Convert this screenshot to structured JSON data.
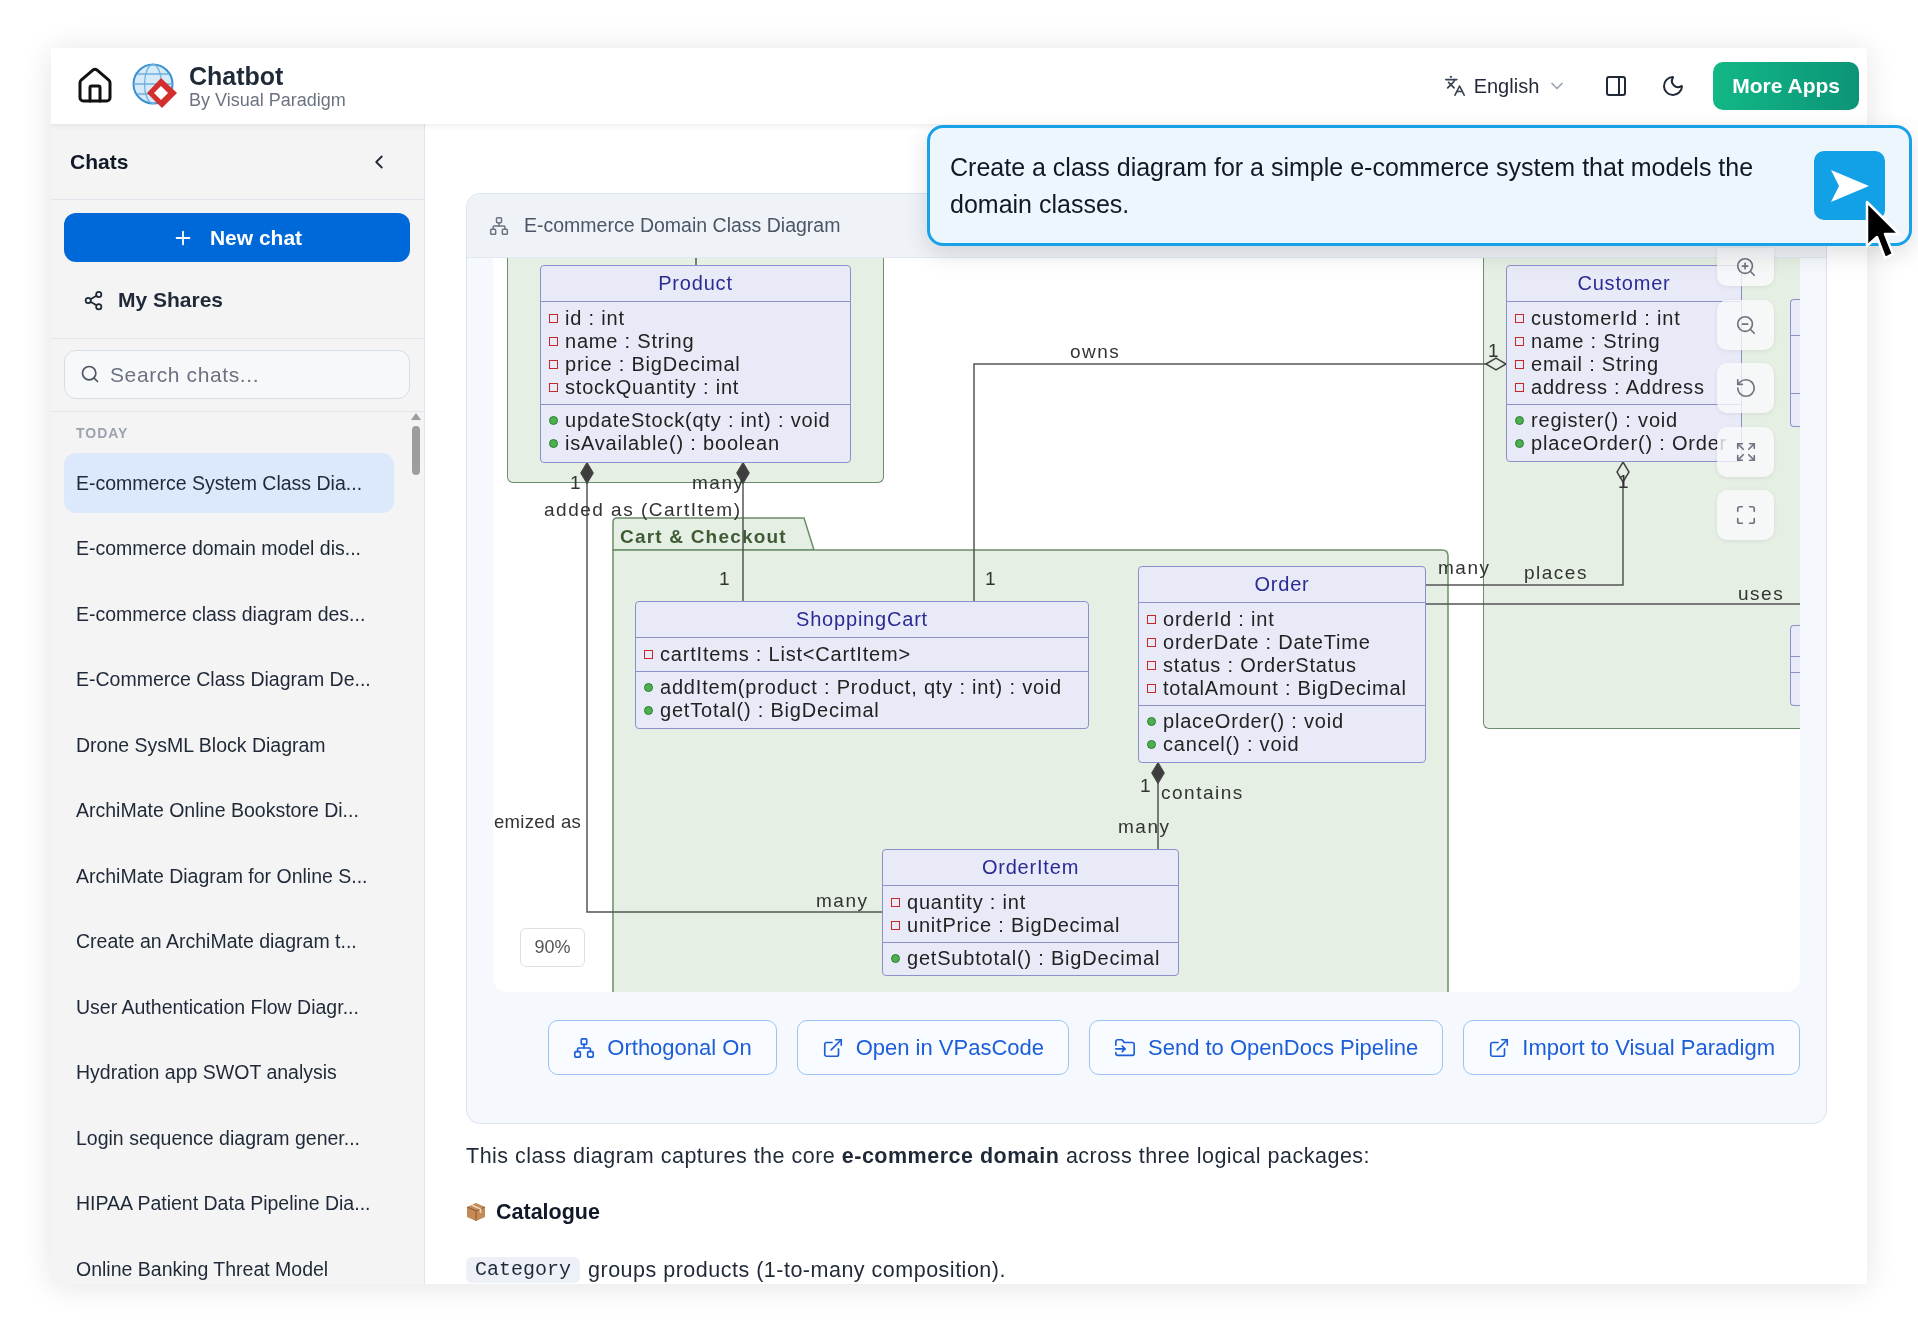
{
  "header": {
    "title": "Chatbot",
    "subtitle": "By Visual Paradigm",
    "language": "English",
    "more_apps": "More Apps"
  },
  "sidebar": {
    "title": "Chats",
    "new_chat": "New chat",
    "my_shares": "My Shares",
    "search": {
      "placeholder": "Search chats..."
    },
    "section": "TODAY",
    "items": [
      {
        "label": "E-commerce System Class Dia...",
        "selected": true
      },
      {
        "label": "E-commerce domain model dis...",
        "selected": false
      },
      {
        "label": "E-commerce class diagram des...",
        "selected": false
      },
      {
        "label": "E-Commerce Class Diagram De...",
        "selected": false
      },
      {
        "label": "Drone SysML Block Diagram",
        "selected": false
      },
      {
        "label": "ArchiMate Online Bookstore Di...",
        "selected": false
      },
      {
        "label": "ArchiMate Diagram for Online S...",
        "selected": false
      },
      {
        "label": "Create an ArchiMate diagram t...",
        "selected": false
      },
      {
        "label": "User Authentication Flow Diagr...",
        "selected": false
      },
      {
        "label": "Hydration app SWOT analysis",
        "selected": false
      },
      {
        "label": "Login sequence diagram gener...",
        "selected": false
      },
      {
        "label": "HIPAA Patient Data Pipeline Dia...",
        "selected": false
      },
      {
        "label": "Online Banking Threat Model",
        "selected": false
      }
    ]
  },
  "prompt": {
    "text": "Create a class diagram for a simple e-commerce system that models the domain classes."
  },
  "diagram": {
    "title": "E-commerce Domain Class Diagram",
    "zoom_level": "90%",
    "packages": [
      {
        "name": "Cart & Checkout"
      }
    ],
    "classes": [
      {
        "name": "Product",
        "attributes": [
          "id : int",
          "name : String",
          "price : BigDecimal",
          "stockQuantity : int"
        ],
        "methods": [
          "updateStock(qty : int) : void",
          "isAvailable() : boolean"
        ]
      },
      {
        "name": "Customer",
        "attributes": [
          "customerId : int",
          "name : String",
          "email : String",
          "address : Address"
        ],
        "methods": [
          "register() : void",
          "placeOrder() : Order"
        ]
      },
      {
        "name": "ShoppingCart",
        "attributes": [
          "cartItems : List<CartItem>"
        ],
        "methods": [
          "addItem(product : Product, qty : int) : void",
          "getTotal() : BigDecimal"
        ]
      },
      {
        "name": "Order",
        "attributes": [
          "orderId : int",
          "orderDate : DateTime",
          "status : OrderStatus",
          "totalAmount : BigDecimal"
        ],
        "methods": [
          "placeOrder() : void",
          "cancel() : void"
        ]
      },
      {
        "name": "OrderItem",
        "attributes": [
          "quantity : int",
          "unitPrice : BigDecimal"
        ],
        "methods": [
          "getSubtotal() : BigDecimal"
        ]
      }
    ],
    "connectors": [
      {
        "kind": "composition",
        "from_multiplicity": "1",
        "label": "emized as",
        "to_multiplicity": "many"
      },
      {
        "kind": "composition",
        "from_multiplicity": "many",
        "label": "added as (CartItem)",
        "to_multiplicity": "1"
      },
      {
        "kind": "aggregation",
        "from_multiplicity": "1",
        "label": "owns",
        "to_multiplicity": "1"
      },
      {
        "kind": "aggregation",
        "from_multiplicity": "1",
        "label": "places",
        "to_multiplicity": "many"
      },
      {
        "kind": "association",
        "label": "uses"
      },
      {
        "kind": "composition",
        "from_multiplicity": "1",
        "label": "contains",
        "to_multiplicity": "many"
      }
    ],
    "actions": [
      "Orthogonal On",
      "Open in VPasCode",
      "Send to OpenDocs Pipeline",
      "Import to Visual Paradigm"
    ]
  },
  "description": {
    "intro": "This class diagram captures the core **e-commerce domain** across three logical packages:",
    "sections": [
      {
        "title": "Catalogue",
        "items": [
          {
            "code": "Category",
            "text": "groups products (1-to-many composition)."
          }
        ]
      }
    ]
  }
}
